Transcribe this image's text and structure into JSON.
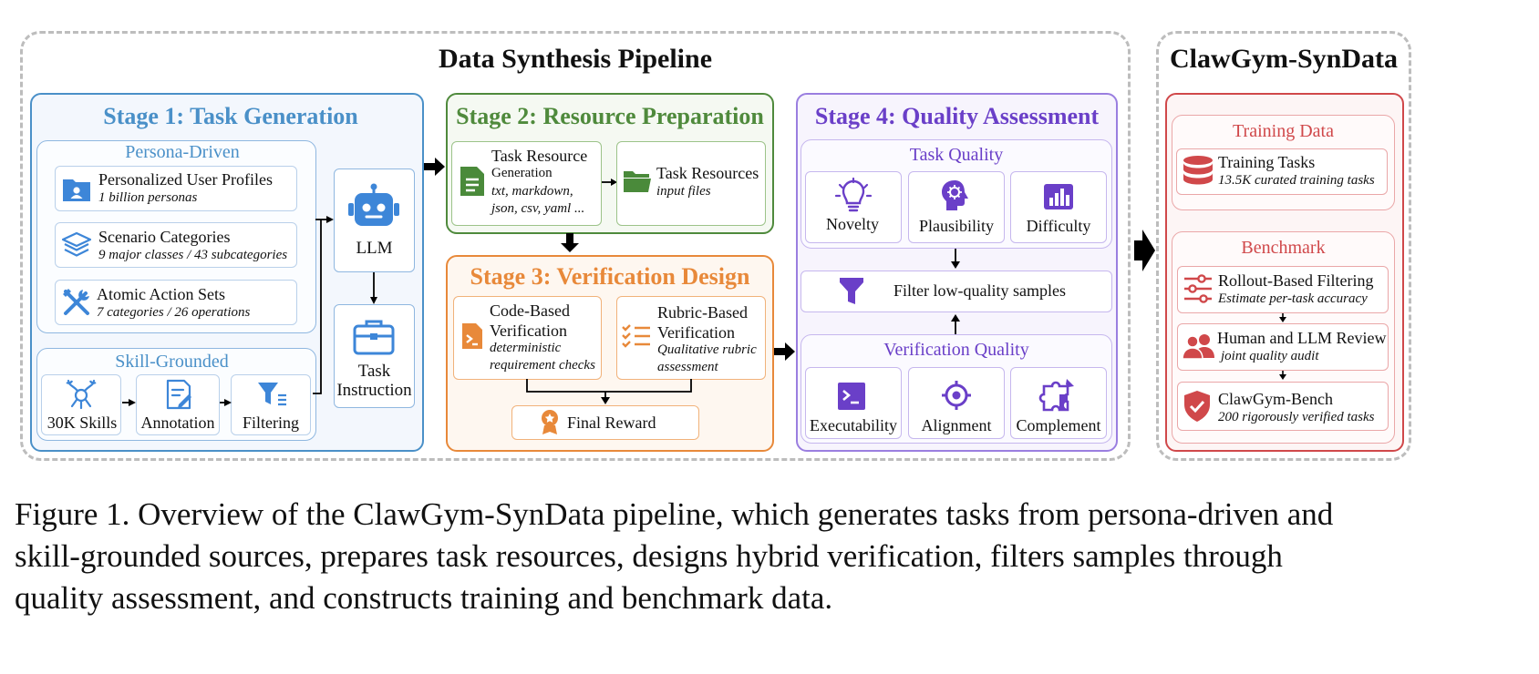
{
  "pipeline": {
    "title": "Data Synthesis Pipeline",
    "stage1": {
      "title": "Stage 1: Task Generation",
      "persona": {
        "title": "Persona-Driven",
        "items": [
          {
            "name": "Personalized User Profiles",
            "sub": "1 billion personas",
            "icon": "user-folder-icon"
          },
          {
            "name": "Scenario Categories",
            "sub": "9 major classes / 43 subcategories",
            "icon": "layers-icon"
          },
          {
            "name": "Atomic Action Sets",
            "sub": "7 categories / 26 operations",
            "icon": "tools-icon"
          }
        ]
      },
      "skill": {
        "title": "Skill-Grounded",
        "items": [
          {
            "label": "30K Skills",
            "icon": "claw-icon"
          },
          {
            "label": "Annotation",
            "icon": "annotate-icon"
          },
          {
            "label": "Filtering",
            "icon": "filter-icon"
          }
        ]
      },
      "llm": {
        "label": "LLM",
        "icon": "robot-icon"
      },
      "task_instruction": {
        "line1": "Task",
        "line2": "Instruction",
        "icon": "briefcase-icon"
      }
    },
    "stage2": {
      "title": "Stage 2: Resource Preparation",
      "gen": {
        "line1": "Task Resource",
        "line2": "Generation",
        "sub1": "txt, markdown,",
        "sub2": "json, csv, yaml ...",
        "icon": "document-icon"
      },
      "res": {
        "line1": "Task Resources",
        "sub": "input files",
        "icon": "folder-icon"
      }
    },
    "stage3": {
      "title": "Stage 3: Verification Design",
      "code": {
        "line1": "Code-Based",
        "line2": "Verification",
        "sub1": "deterministic",
        "sub2": "requirement checks",
        "icon": "code-file-icon"
      },
      "rubric": {
        "line1": "Rubric-Based",
        "line2": "Verification",
        "sub1": "Qualitative rubric",
        "sub2": "assessment",
        "icon": "checklist-icon"
      },
      "reward": {
        "label": "Final Reward",
        "icon": "medal-icon"
      }
    },
    "stage4": {
      "title": "Stage 4: Quality Assessment",
      "task_quality": {
        "title": "Task Quality",
        "items": [
          {
            "label": "Novelty",
            "icon": "lightbulb-icon"
          },
          {
            "label": "Plausibility",
            "icon": "brain-icon"
          },
          {
            "label": "Difficulty",
            "icon": "bar-chart-icon"
          }
        ]
      },
      "filter": {
        "label": "Filter low-quality samples",
        "icon": "funnel-icon"
      },
      "verif_quality": {
        "title": "Verification Quality",
        "items": [
          {
            "label": "Executability",
            "icon": "terminal-icon"
          },
          {
            "label": "Alignment",
            "icon": "target-icon"
          },
          {
            "label": "Complement",
            "icon": "puzzle-icon"
          }
        ]
      }
    }
  },
  "syndata": {
    "title": "ClawGym-SynData",
    "training": {
      "title": "Training Data",
      "item": {
        "name": "Training Tasks",
        "sub": "13.5K curated training tasks",
        "icon": "database-icon"
      }
    },
    "benchmark": {
      "title": "Benchmark",
      "items": [
        {
          "name": "Rollout-Based Filtering",
          "sub": "Estimate per-task accuracy",
          "icon": "sliders-icon"
        },
        {
          "name": "Human and LLM Review",
          "sub": "joint quality audit",
          "icon": "users-icon"
        },
        {
          "name": "ClawGym-Bench",
          "sub": "200 rigorously verified tasks",
          "icon": "shield-check-icon"
        }
      ]
    }
  },
  "caption": {
    "line1": "Figure 1. Overview of the ClawGym-SynData pipeline, which generates tasks from persona-driven and",
    "line2": "skill-grounded sources, prepares task resources, designs hybrid verification, filters samples through",
    "line3": "quality assessment, and constructs training and benchmark data."
  },
  "colors": {
    "stage1": "#4a90c8",
    "stage2": "#4f8a3c",
    "stage3": "#e8893a",
    "stage4": "#6a3fc8",
    "syndata": "#d0484a"
  }
}
